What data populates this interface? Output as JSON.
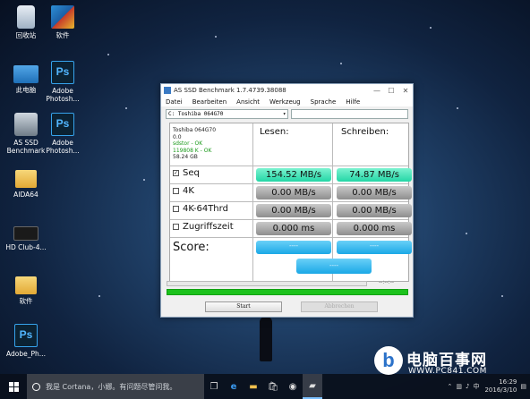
{
  "desktop": {
    "icons": [
      {
        "label": "回收站",
        "icon": "recycle-bin-icon"
      },
      {
        "label": "软件",
        "icon": "winrar-icon"
      },
      {
        "label": "此电脑",
        "icon": "this-pc-icon"
      },
      {
        "label": "Adobe Photosh...",
        "icon": "photoshop-icon"
      },
      {
        "label": "AS SSD Benchmark",
        "icon": "as-ssd-icon"
      },
      {
        "label": "Adobe Photosh...",
        "icon": "photoshop-icon"
      },
      {
        "label": "AIDA64",
        "icon": "folder-icon"
      },
      {
        "label": "HD Club-4...",
        "icon": "hdclub-icon"
      },
      {
        "label": "软件",
        "icon": "folder-icon"
      },
      {
        "label": "Adobe_Ph...",
        "icon": "photoshop-icon"
      }
    ],
    "ps_glyph": "Ps"
  },
  "window": {
    "title": "AS SSD Benchmark 1.7.4739.38088",
    "controls": {
      "minimize": "—",
      "maximize": "☐",
      "close": "✕"
    },
    "menu": [
      "Datei",
      "Bearbeiten",
      "Ansicht",
      "Werkzeug",
      "Sprache",
      "Hilfe"
    ],
    "drive_select": "C: Toshiba 064G70",
    "drive_info": {
      "model": "Toshiba 064G70",
      "firmware": "0.0",
      "driver": "sdstor - OK",
      "alignment": "119808 K - OK",
      "size": "58.24 GB"
    },
    "columns": {
      "read": "Lesen:",
      "write": "Schreiben:"
    },
    "tests": [
      {
        "label": "Seq",
        "checked": true,
        "read": "154.52 MB/s",
        "write": "74.87 MB/s",
        "state": "done"
      },
      {
        "label": "4K",
        "checked": false,
        "read": "0.00 MB/s",
        "write": "0.00 MB/s",
        "state": "idle"
      },
      {
        "label": "4K-64Thrd",
        "checked": false,
        "read": "0.00 MB/s",
        "write": "0.00 MB/s",
        "state": "idle"
      },
      {
        "label": "Zugriffszeit",
        "checked": false,
        "read": "0.000 ms",
        "write": "0.000 ms",
        "state": "idle"
      }
    ],
    "score": {
      "label": "Score:",
      "read": "----",
      "write": "----",
      "total": "----"
    },
    "progress_time": "--:--:--",
    "progress_complete": 1.0,
    "buttons": {
      "start": "Start",
      "abort": "Abbrechen"
    }
  },
  "taskbar": {
    "search_placeholder": "我是 Cortana，小娜。有问题尽管问我。",
    "tray": {
      "ime": "中",
      "time": "16:29",
      "date": "2016/3/10"
    }
  },
  "watermark": {
    "logo_glyph": "b",
    "title": "电脑百事网",
    "url": "WWW.PC841.COM"
  },
  "colors": {
    "read_green": "#24d6a6",
    "idle_gray": "#8e8e8e",
    "score_blue": "#1ba8e6",
    "progress_green": "#1cc21c"
  }
}
